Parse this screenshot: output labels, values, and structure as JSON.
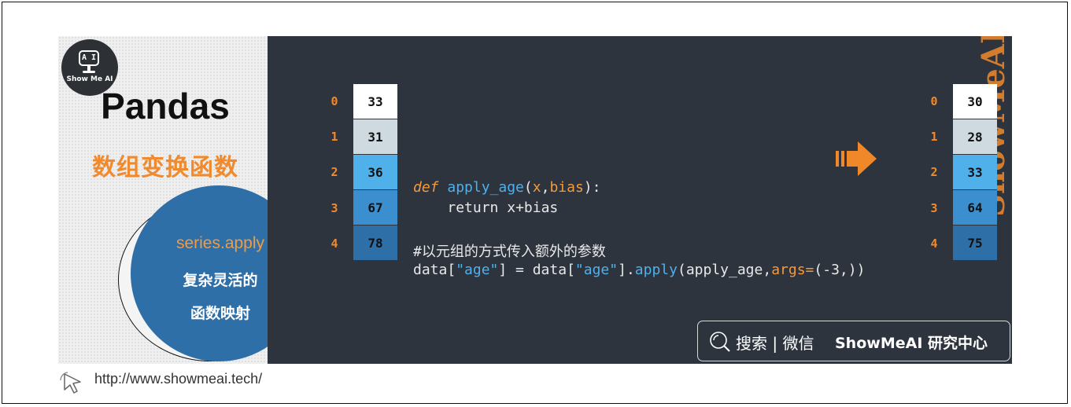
{
  "brand": {
    "logo_text": "Show Me AI",
    "logo_glyph": "A I"
  },
  "heading": {
    "title": "Pandas",
    "subtitle": "数组变换函数"
  },
  "badge": {
    "title": "series.apply",
    "line1": "复杂灵活的",
    "line2": "函数映射"
  },
  "input_series": {
    "index": [
      "0",
      "1",
      "2",
      "3",
      "4"
    ],
    "values": [
      "33",
      "31",
      "36",
      "67",
      "78"
    ],
    "colors": [
      "#ffffff",
      "#cfd9e0",
      "#4fb0ea",
      "#3b8fcf",
      "#2f6fa8"
    ]
  },
  "output_series": {
    "index": [
      "0",
      "1",
      "2",
      "3",
      "4"
    ],
    "values": [
      "30",
      "28",
      "33",
      "64",
      "75"
    ],
    "colors": [
      "#ffffff",
      "#cfd9e0",
      "#4fb0ea",
      "#3b8fcf",
      "#2f6fa8"
    ]
  },
  "code": {
    "def_kw": "def",
    "func_name": "apply_age",
    "open_paren": "(",
    "param_x": "x",
    "comma": ",",
    "param_bias": "bias",
    "close": "):",
    "indent": "    ",
    "return_kw": "return",
    "return_expr": " x+bias",
    "comment": "#以元组的方式传入额外的参数",
    "l4_a": "data[",
    "l4_str1": "\"age\"",
    "l4_b": "] = data[",
    "l4_str2": "\"age\"",
    "l4_c": "].",
    "l4_apply": "apply",
    "l4_d": "(apply_age,",
    "l4_args": "args=",
    "l4_e": "(-3,))"
  },
  "watermark": "ShowMeAI",
  "search": {
    "text": "搜索 | 微信",
    "brand": "ShowMeAI 研究中心"
  },
  "footer": {
    "url": "http://www.showmeai.tech/"
  },
  "colors": {
    "accent": "#f08a2c",
    "panel": "#2e343e",
    "blue": "#2f6fa8",
    "arrow": "#f0882a"
  }
}
